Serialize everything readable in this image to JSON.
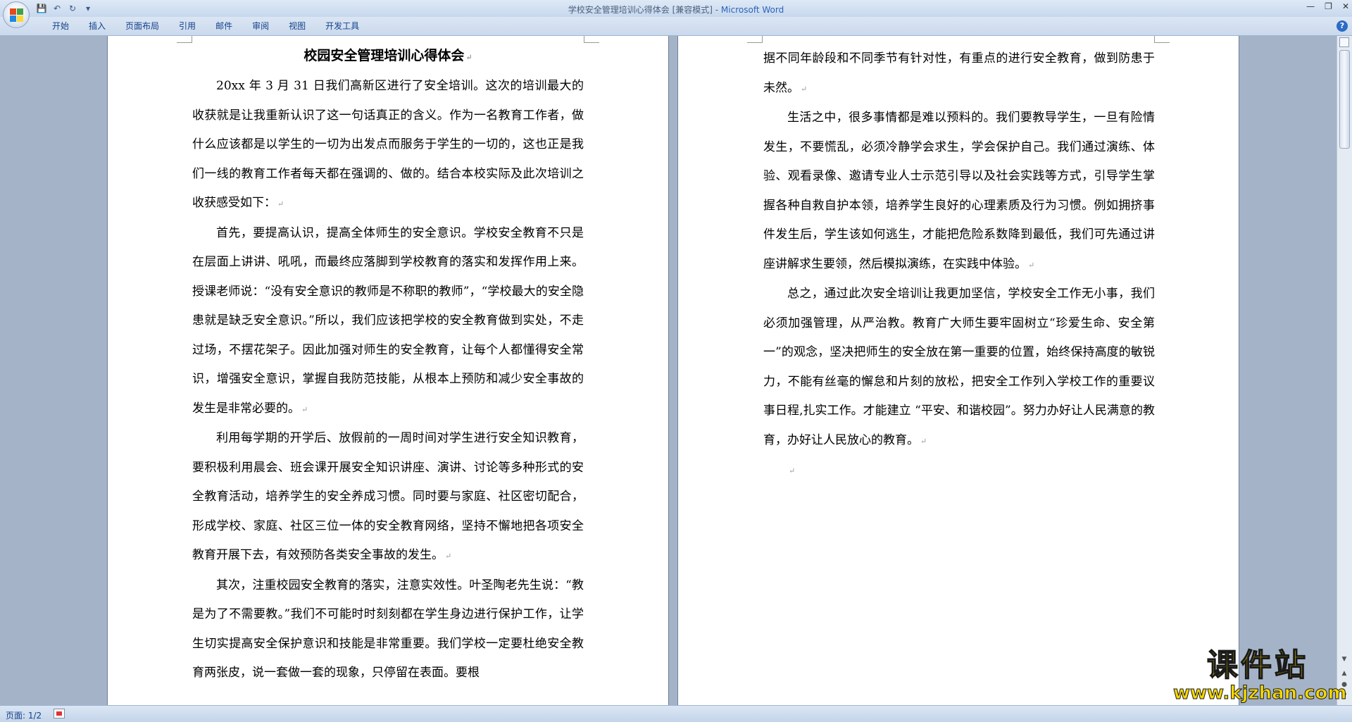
{
  "window": {
    "title": "学校安全管理培训心得体会 [兼容模式] - ",
    "app_name": "Microsoft Word"
  },
  "quick_access": {
    "icons": [
      "save-icon",
      "undo-icon",
      "redo-icon",
      "customize-icon"
    ]
  },
  "ribbon": {
    "tabs": [
      {
        "label": "开始"
      },
      {
        "label": "插入"
      },
      {
        "label": "页面布局"
      },
      {
        "label": "引用"
      },
      {
        "label": "邮件"
      },
      {
        "label": "审阅"
      },
      {
        "label": "视图"
      },
      {
        "label": "开发工具"
      }
    ],
    "help_label": "?"
  },
  "document": {
    "title": "校园安全管理培训心得体会",
    "page1_paragraphs": [
      "20xx 年 3 月 31 日我们高新区进行了安全培训。这次的培训最大的收获就是让我重新认识了这一句话真正的含义。作为一名教育工作者，做什么应该都是以学生的一切为出发点而服务于学生的一切的，这也正是我们一线的教育工作者每天都在强调的、做的。结合本校实际及此次培训之收获感受如下：",
      "首先，要提高认识，提高全体师生的安全意识。学校安全教育不只是在层面上讲讲、吼吼，而最终应落脚到学校教育的落实和发挥作用上来。授课老师说：“没有安全意识的教师是不称职的教师”，“学校最大的安全隐患就是缺乏安全意识。”所以，我们应该把学校的安全教育做到实处，不走过场，不摆花架子。因此加强对师生的安全教育，让每个人都懂得安全常识，增强安全意识，掌握自我防范技能，从根本上预防和减少安全事故的发生是非常必要的。",
      "利用每学期的开学后、放假前的一周时间对学生进行安全知识教育，要积极利用晨会、班会课开展安全知识讲座、演讲、讨论等多种形式的安全教育活动，培养学生的安全养成习惯。同时要与家庭、社区密切配合，形成学校、家庭、社区三位一体的安全教育网络，坚持不懈地把各项安全教育开展下去，有效预防各类安全事故的发生。",
      "其次，注重校园安全教育的落实，注意实效性。叶圣陶老先生说：“教是为了不需要教。”我们不可能时时刻刻都在学生身边进行保护工作，让学生切实提高安全保护意识和技能是非常重要。我们学校一定要杜绝安全教育两张皮，说一套做一套的现象，只停留在表面。要根"
    ],
    "page2_first": "据不同年龄段和不同季节有针对性，有重点的进行安全教育，做到防患于未然。",
    "page2_paragraphs": [
      "生活之中，很多事情都是难以预料的。我们要教导学生，一旦有险情发生，不要慌乱，必须冷静学会求生，学会保护自己。我们通过演练、体验、观看录像、邀请专业人士示范引导以及社会实践等方式，引导学生掌握各种自救自护本领，培养学生良好的心理素质及行为习惯。例如拥挤事件发生后，学生该如何逃生，才能把危险系数降到最低，我们可先通过讲座讲解求生要领，然后模拟演练，在实践中体验。",
      "总之，通过此次安全培训让我更加坚信，学校安全工作无小事，我们必须加强管理，从严治教。教育广大师生要牢固树立“珍爱生命、安全第一”的观念，坚决把师生的安全放在第一重要的位置，始终保持高度的敏锐力，不能有丝毫的懈怠和片刻的放松，把安全工作列入学校工作的重要议事日程,扎实工作。才能建立 “平安、和谐校园”。努力办好让人民满意的教育，办好让人民放心的教育。"
    ]
  },
  "statusbar": {
    "page_count": "页面: 1/2"
  },
  "watermark": {
    "title": "课件站",
    "url": "www.kjzhan.com"
  }
}
